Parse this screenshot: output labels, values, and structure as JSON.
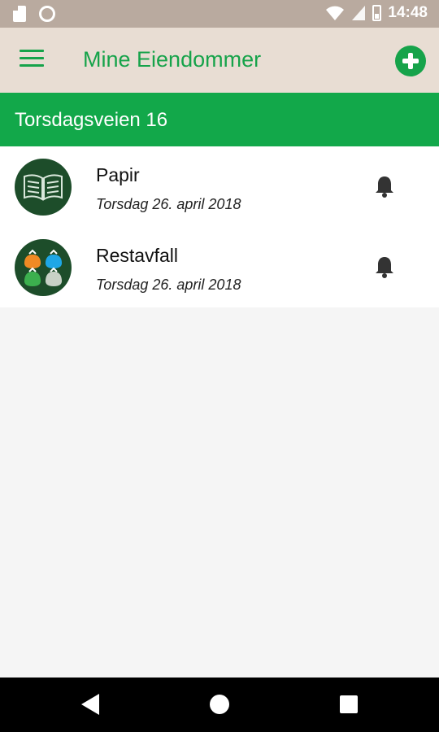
{
  "status_bar": {
    "time": "14:48",
    "icons": [
      "sd-card-icon",
      "circle-icon",
      "wifi-icon",
      "signal-icon",
      "battery-icon"
    ]
  },
  "app_bar": {
    "title": "Mine Eiendommer",
    "menu_icon": "hamburger-menu-icon",
    "add_icon": "add-circle-icon",
    "accent_color": "#16a34a"
  },
  "address": {
    "label": "Torsdagsveien 16",
    "background_color": "#12a84a"
  },
  "items": [
    {
      "title": "Papir",
      "date": "Torsdag 26. april 2018",
      "icon": "paper-book-icon",
      "bell_icon": "bell-icon"
    },
    {
      "title": "Restavfall",
      "date": "Torsdag 26. april 2018",
      "icon": "waste-bags-icon",
      "bell_icon": "bell-icon"
    }
  ],
  "nav_bar": {
    "back_icon": "back-triangle-icon",
    "home_icon": "home-circle-icon",
    "recent_icon": "recent-square-icon"
  }
}
